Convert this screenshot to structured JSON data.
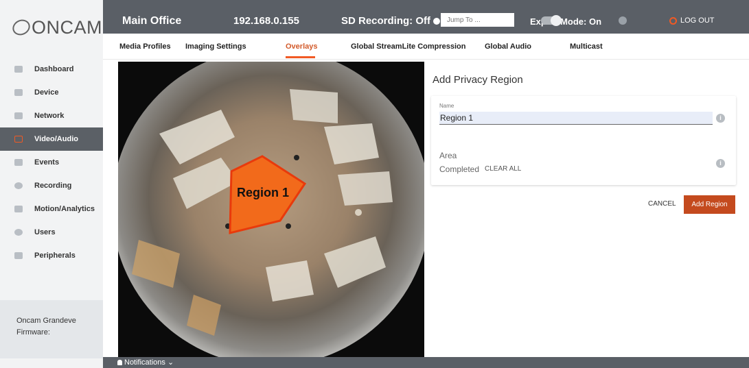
{
  "logo": {
    "text": "ONCAM"
  },
  "sidebar": {
    "items": [
      {
        "label": "Dashboard",
        "icon": "grid-icon"
      },
      {
        "label": "Device",
        "icon": "camera-icon"
      },
      {
        "label": "Network",
        "icon": "network-icon"
      },
      {
        "label": "Video/Audio",
        "icon": "video-icon",
        "active": true
      },
      {
        "label": "Events",
        "icon": "calendar-icon"
      },
      {
        "label": "Recording",
        "icon": "record-icon"
      },
      {
        "label": "Motion/Analytics",
        "icon": "chart-icon"
      },
      {
        "label": "Users",
        "icon": "user-icon"
      },
      {
        "label": "Peripherals",
        "icon": "usb-icon"
      }
    ],
    "firmware_line1": "Oncam Grandeve",
    "firmware_line2": "Firmware:"
  },
  "topbar": {
    "location": "Main Office",
    "ip": "192.168.0.155",
    "sd_recording": "SD Recording: Off",
    "jump_placeholder": "Jump To ...",
    "expert_mode": "Expert Mode: On",
    "logout": "LOG OUT"
  },
  "tabs": [
    {
      "label": "Media Profiles"
    },
    {
      "label": "Imaging Settings"
    },
    {
      "label": "Overlays",
      "active": true
    },
    {
      "label": "Global StreamLite Compression"
    },
    {
      "label": "Global Audio"
    },
    {
      "label": "Multicast"
    }
  ],
  "camera": {
    "region_label": "Region 1"
  },
  "form": {
    "title": "Add Privacy Region",
    "name_label": "Name",
    "name_value": "Region 1",
    "area_label": "Area",
    "area_status": "Completed",
    "clear_all": "CLEAR ALL",
    "cancel": "CANCEL",
    "add_region": "Add Region"
  },
  "bottombar": {
    "notifications": "Notifications"
  },
  "colors": {
    "accent": "#f15a24",
    "topbar": "#5a5f66",
    "button": "#c44a1e"
  }
}
